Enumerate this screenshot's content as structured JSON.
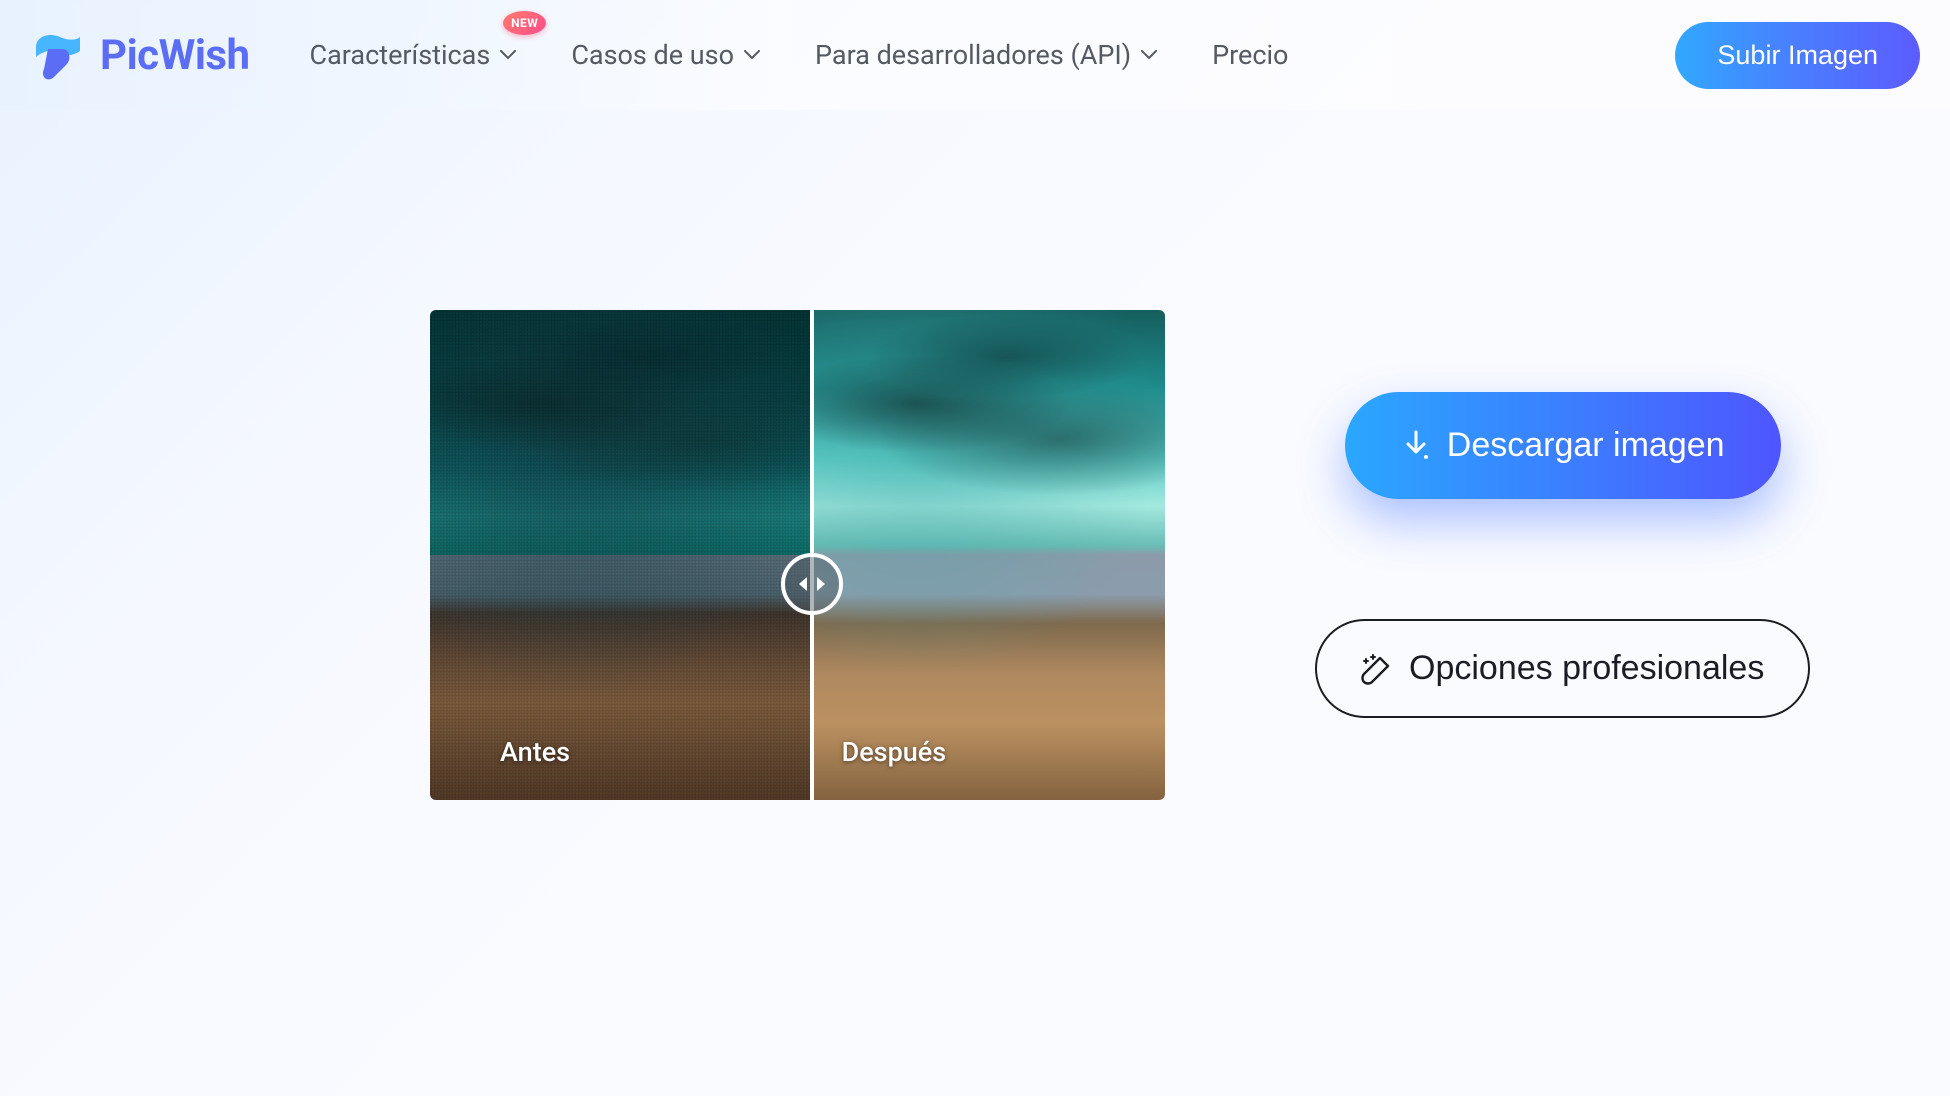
{
  "brand": {
    "name": "PicWish"
  },
  "nav": {
    "items": [
      {
        "label": "Características",
        "badge": "NEW"
      },
      {
        "label": "Casos de uso"
      },
      {
        "label": "Para desarrolladores (API)"
      },
      {
        "label": "Precio"
      }
    ],
    "upload_label": "Subir Imagen"
  },
  "compare": {
    "before_label": "Antes",
    "after_label": "Después"
  },
  "actions": {
    "download_label": "Descargar imagen",
    "pro_label": "Opciones profesionales"
  }
}
